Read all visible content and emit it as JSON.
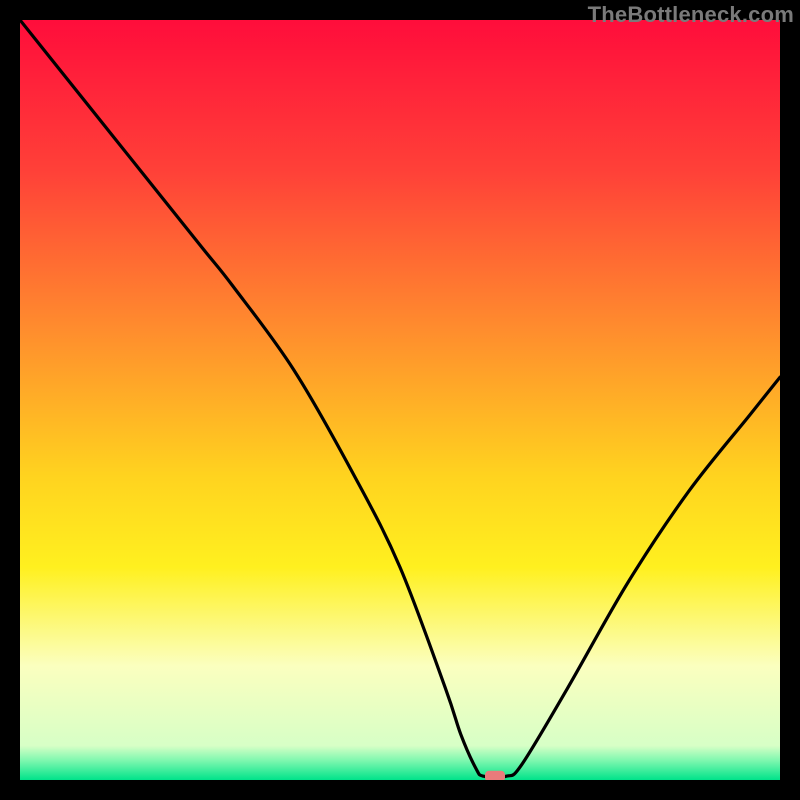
{
  "attribution": "TheBottleneck.com",
  "chart_data": {
    "type": "line",
    "title": "",
    "xlabel": "",
    "ylabel": "",
    "xlim": [
      0,
      100
    ],
    "ylim": [
      0,
      100
    ],
    "x": [
      0,
      8,
      16,
      24,
      28,
      36,
      44,
      50,
      56,
      58,
      60,
      61,
      64,
      66,
      72,
      80,
      88,
      96,
      100
    ],
    "values": [
      100,
      90,
      80,
      70,
      65,
      54,
      40,
      28,
      12,
      6,
      1.5,
      0.5,
      0.5,
      2,
      12,
      26,
      38,
      48,
      53
    ],
    "marker": {
      "x": 62.5,
      "y": 0.5
    },
    "gradient_bands": [
      {
        "stop": 0.0,
        "color": "#ff0d3b"
      },
      {
        "stop": 0.2,
        "color": "#ff4138"
      },
      {
        "stop": 0.4,
        "color": "#ff8a2e"
      },
      {
        "stop": 0.6,
        "color": "#ffd31f"
      },
      {
        "stop": 0.72,
        "color": "#fff01f"
      },
      {
        "stop": 0.85,
        "color": "#fbffbf"
      },
      {
        "stop": 0.955,
        "color": "#d7ffc6"
      },
      {
        "stop": 0.975,
        "color": "#7bf7ae"
      },
      {
        "stop": 1.0,
        "color": "#00e38a"
      }
    ],
    "marker_color": "#e97b7b",
    "curve_color": "#000000"
  }
}
